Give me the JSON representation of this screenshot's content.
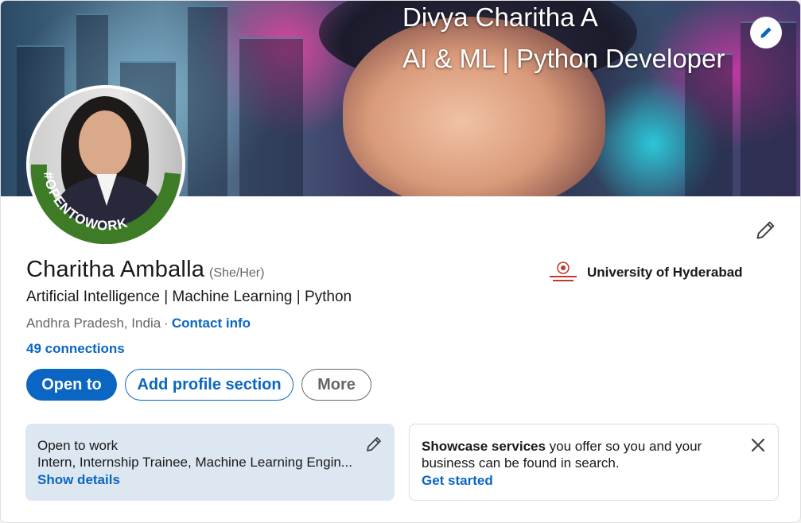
{
  "banner": {
    "title": "Divya Charitha A",
    "subtitle": "AI & ML | Python Developer",
    "edit_icon": "pencil-icon"
  },
  "avatar": {
    "badge_text": "#OPENTOWORK",
    "badge_color": "#3e7b27"
  },
  "profile": {
    "name": "Charitha Amballa",
    "pronouns": "(She/Her)",
    "headline": "Artificial Intelligence | Machine Learning | Python",
    "location": "Andhra Pradesh, India",
    "separator": "·",
    "contact_info": "Contact info",
    "connections": "49 connections"
  },
  "education": {
    "name": "University of Hyderabad",
    "logo_icon": "university-crest-icon"
  },
  "actions": {
    "open_to": "Open to",
    "add_profile_section": "Add profile section",
    "more": "More"
  },
  "open_to_work": {
    "title": "Open to work",
    "roles": "Intern, Internship Trainee, Machine Learning Engin...",
    "link": "Show details",
    "edit_icon": "pencil-icon"
  },
  "showcase": {
    "title_bold": "Showcase services",
    "title_rest": " you offer so you and your",
    "line2": "business can be found in search.",
    "link": "Get started",
    "close_icon": "close-icon"
  },
  "colors": {
    "brand_blue": "#0a66c2",
    "otw_green": "#3e7b27",
    "otw_box_bg": "#dde7f1"
  }
}
